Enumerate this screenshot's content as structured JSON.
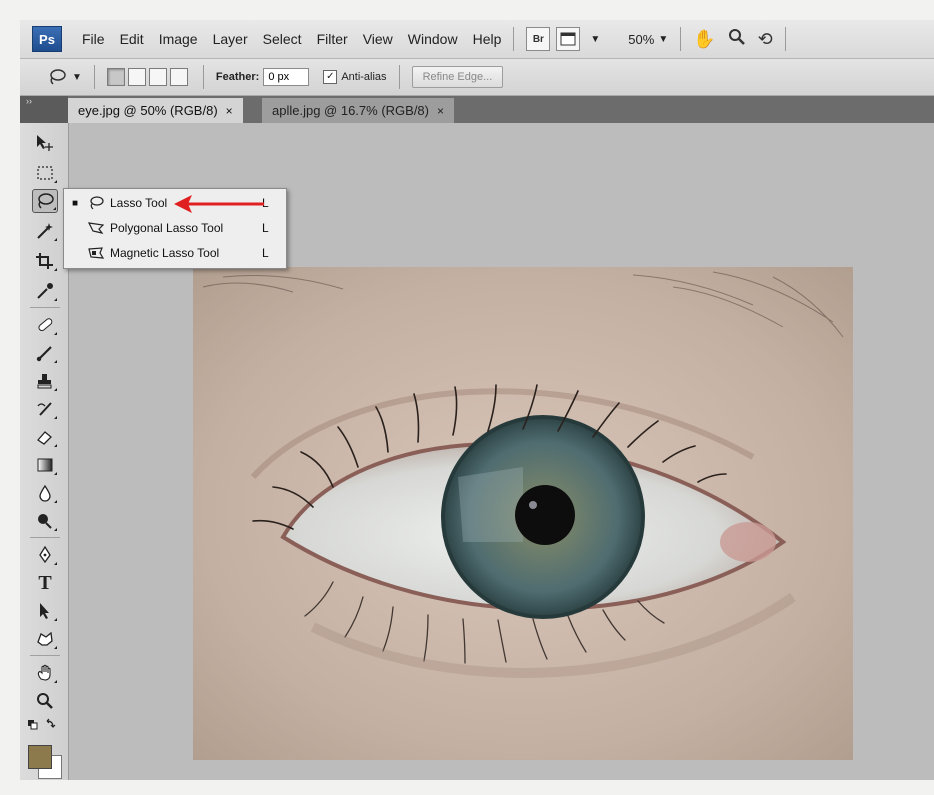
{
  "menubar": {
    "logo": "Ps",
    "items": [
      "File",
      "Edit",
      "Image",
      "Layer",
      "Select",
      "Filter",
      "View",
      "Window",
      "Help"
    ],
    "bridge_label": "Br",
    "zoom_value": "50%"
  },
  "options": {
    "feather_label": "Feather:",
    "feather_value": "0 px",
    "antialias_label": "Anti-alias",
    "antialias_checked_glyph": "✓",
    "refine_edge_label": "Refine Edge..."
  },
  "tabs": [
    {
      "label": "eye.jpg @ 50% (RGB/8)",
      "close": "×"
    },
    {
      "label": "aplle.jpg @ 16.7% (RGB/8)",
      "close": "×"
    }
  ],
  "panel_grip": "››",
  "toolbox": {
    "text_tool_glyph": "T",
    "foreground_color": "#8c7a4d",
    "background_color": "#ffffff"
  },
  "popup": {
    "items": [
      {
        "label": "Lasso Tool",
        "shortcut": "L",
        "selected_marker": "■",
        "icon": "lasso-icon"
      },
      {
        "label": "Polygonal Lasso Tool",
        "shortcut": "L",
        "selected_marker": "",
        "icon": "polygonal-lasso-icon"
      },
      {
        "label": "Magnetic Lasso Tool",
        "shortcut": "L",
        "selected_marker": "",
        "icon": "magnetic-lasso-icon"
      }
    ]
  },
  "colors": {
    "arrow": "#e02020",
    "iris": "#4f6c70",
    "skin": "#c8b7ab"
  }
}
